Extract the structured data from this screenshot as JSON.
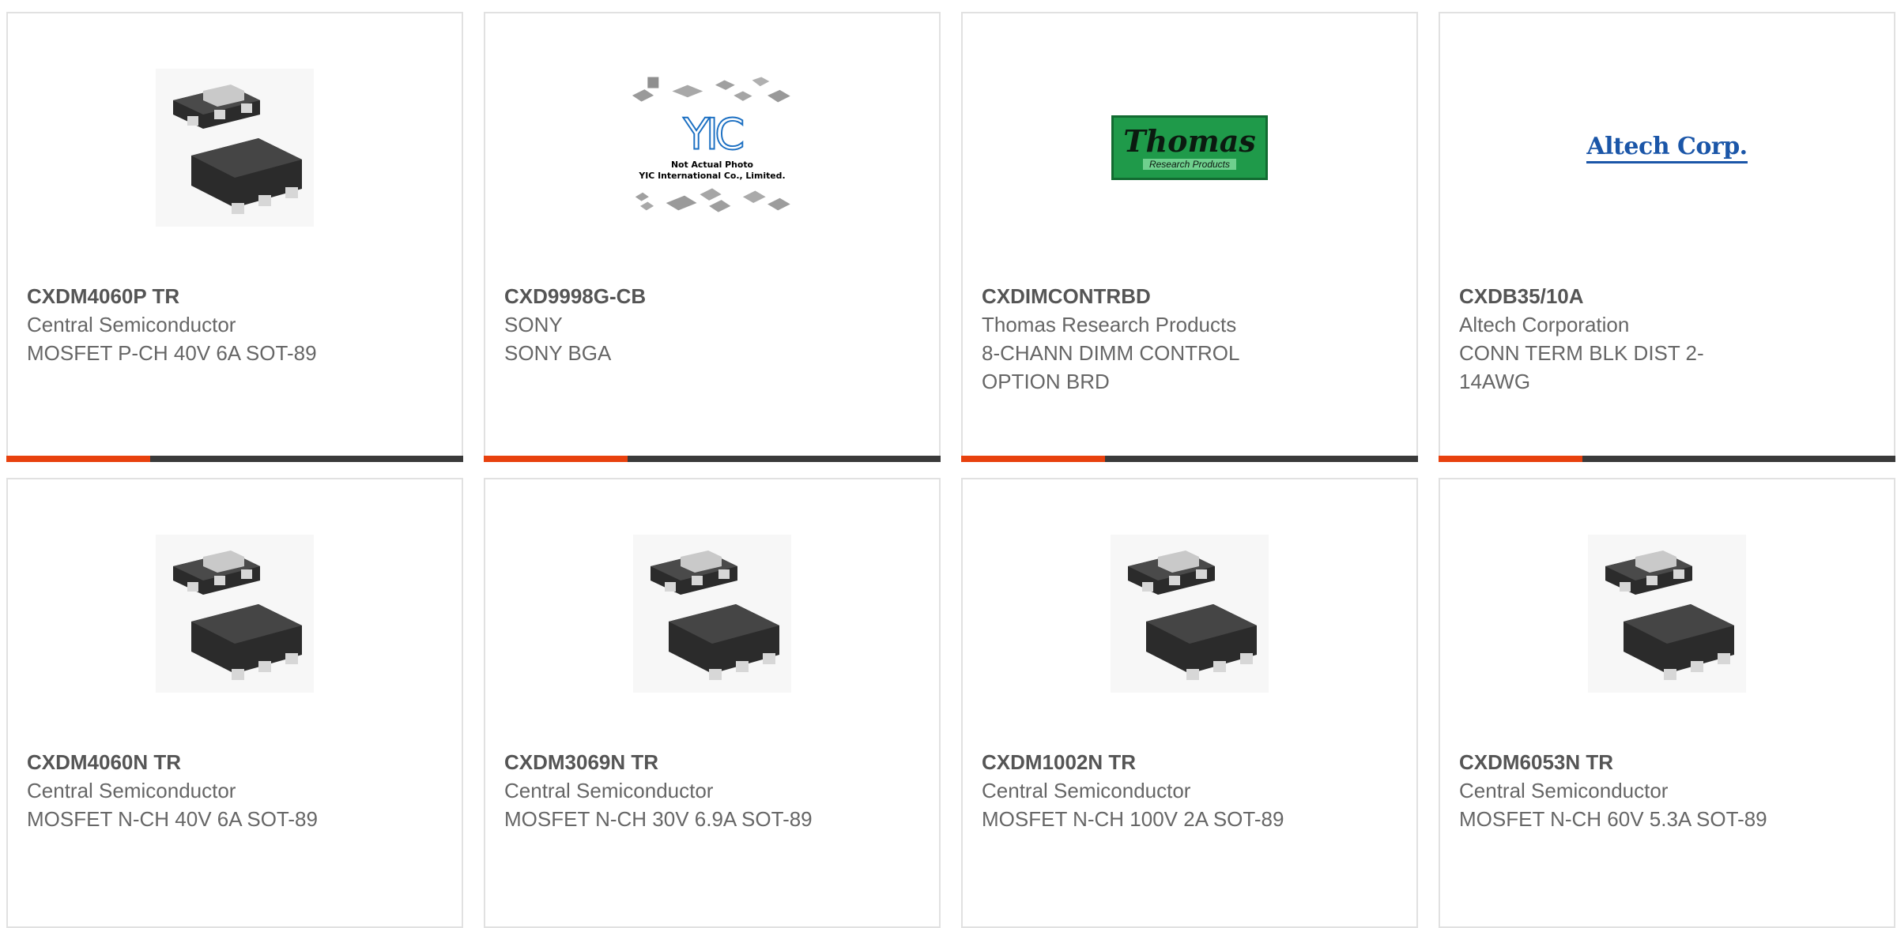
{
  "theme": {
    "accent": "#e8410e",
    "bar_base": "#3a3a3a",
    "card_border": "#e1e1e1",
    "title_color": "#555555",
    "text_color": "#666666"
  },
  "products": [
    {
      "part_number": "CXDM4060P TR",
      "manufacturer": "Central Semiconductor",
      "description": "MOSFET P-CH 40V 6A SOT-89",
      "image": "sot89-package-icon"
    },
    {
      "part_number": "CXD9998G-CB",
      "manufacturer": "SONY",
      "description": "SONY BGA",
      "image": "yic-placeholder-image",
      "image_text": {
        "logo": "YIC",
        "line1": "Not Actual Photo",
        "line2": "YIC International Co., Limited."
      }
    },
    {
      "part_number": "CXDIMCONTRBD",
      "manufacturer": "Thomas Research Products",
      "description": "8-CHANN DIMM CONTROL OPTION BRD",
      "image": "thomas-logo",
      "image_text": {
        "line1": "Thomas",
        "line2": "Research Products"
      }
    },
    {
      "part_number": "CXDB35/10A",
      "manufacturer": "Altech Corporation",
      "description": "CONN TERM BLK DIST 2-14AWG",
      "image": "altech-logo",
      "image_text": {
        "line1": "Altech Corp."
      }
    },
    {
      "part_number": "CXDM4060N TR",
      "manufacturer": "Central Semiconductor",
      "description": "MOSFET N-CH 40V 6A SOT-89",
      "image": "sot89-package-icon"
    },
    {
      "part_number": "CXDM3069N TR",
      "manufacturer": "Central Semiconductor",
      "description": "MOSFET N-CH 30V 6.9A SOT-89",
      "image": "sot89-package-icon"
    },
    {
      "part_number": "CXDM1002N TR",
      "manufacturer": "Central Semiconductor",
      "description": "MOSFET N-CH 100V 2A SOT-89",
      "image": "sot89-package-icon"
    },
    {
      "part_number": "CXDM6053N TR",
      "manufacturer": "Central Semiconductor",
      "description": "MOSFET N-CH 60V 5.3A SOT-89",
      "image": "sot89-package-icon"
    }
  ]
}
